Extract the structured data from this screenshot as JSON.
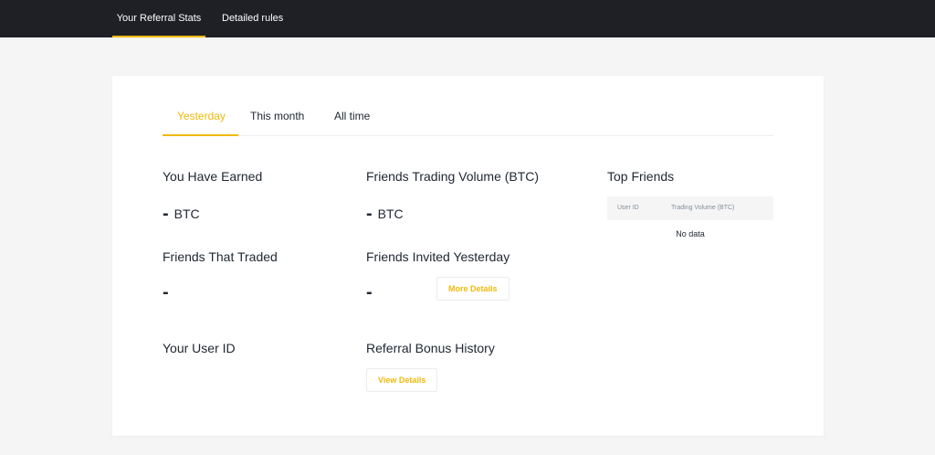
{
  "topnav": {
    "tabs": [
      {
        "label": "Your Referral Stats",
        "active": true
      },
      {
        "label": "Detailed rules",
        "active": false
      }
    ]
  },
  "period_tabs": [
    {
      "label": "Yesterday",
      "active": true
    },
    {
      "label": "This month",
      "active": false
    },
    {
      "label": "All time",
      "active": false
    }
  ],
  "stats": {
    "earned": {
      "label": "You Have Earned",
      "value": "-",
      "unit": "BTC"
    },
    "volume": {
      "label": "Friends Trading Volume (BTC)",
      "value": "-",
      "unit": "BTC"
    },
    "traded": {
      "label": "Friends That Traded",
      "value": "-"
    },
    "invited": {
      "label": "Friends Invited Yesterday",
      "value": "-",
      "button": "More Details"
    },
    "user_id": {
      "label": "Your User ID"
    },
    "bonus_history": {
      "label": "Referral Bonus History",
      "button": "View Details"
    }
  },
  "top_friends": {
    "title": "Top Friends",
    "columns": [
      "User ID",
      "Trading Volume (BTC)"
    ],
    "empty_text": "No data"
  },
  "colors": {
    "accent": "#f0b90b",
    "nav_bg": "#1e2026",
    "page_bg": "#f5f5f5"
  }
}
